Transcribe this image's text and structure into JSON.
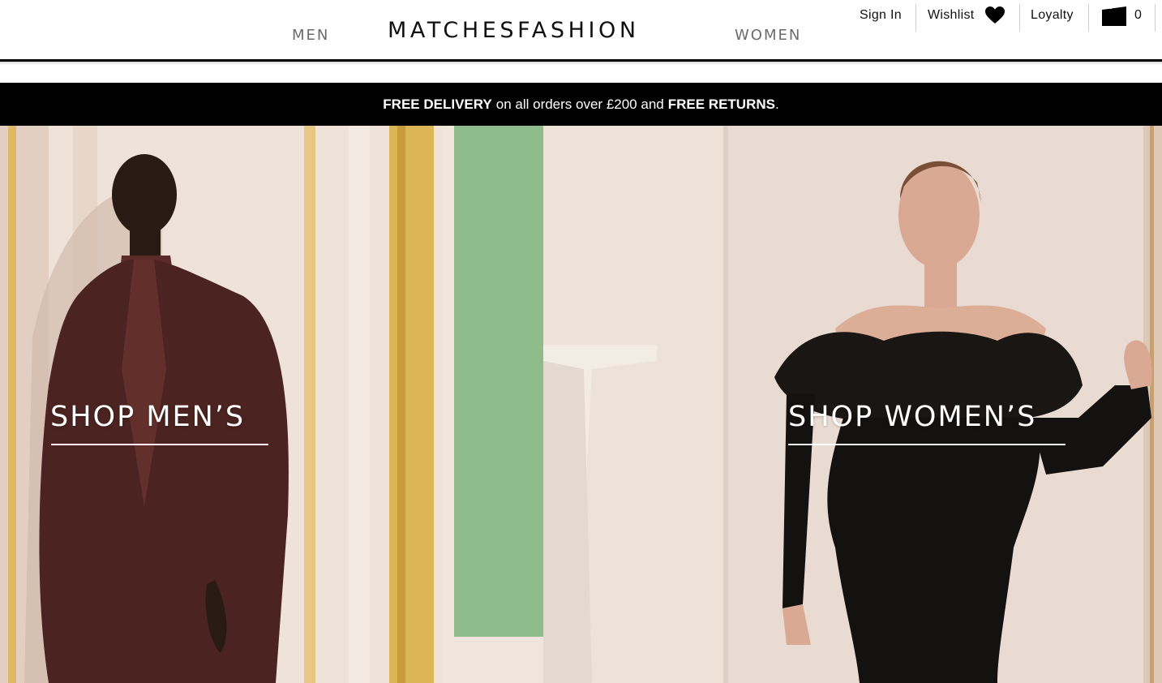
{
  "header": {
    "logo": "MATCHESFASHION",
    "nav_men": "MEN",
    "nav_women": "WOMEN",
    "sign_in": "Sign In",
    "wishlist": "Wishlist",
    "loyalty": "Loyalty",
    "bag_count": "0",
    "icons": {
      "wishlist": "heart-icon",
      "bag": "shopping-bag-icon"
    }
  },
  "promo": {
    "part1": "FREE DELIVERY",
    "part2": "on all orders over £200 and",
    "part3": "FREE RETURNS",
    "part4": "."
  },
  "hero": {
    "men_cta": "SHOP MEN’S",
    "women_cta": "SHOP WOMEN’S"
  },
  "colors": {
    "text": "#111111",
    "nav_gray": "#6b6b6b",
    "promo_bg": "#000000",
    "wall": "#eadbd2",
    "green_panel": "#8fbc8b",
    "gold_trim": "#d9b55a",
    "suit": "#4b2320",
    "dress": "#141111"
  }
}
